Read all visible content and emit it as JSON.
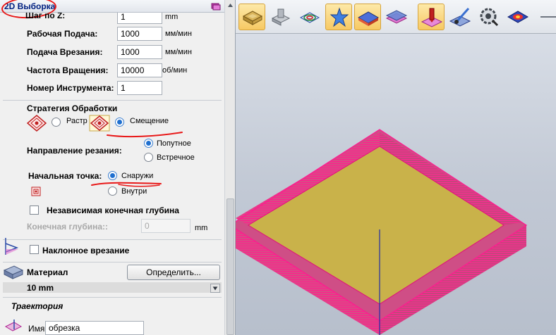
{
  "panel": {
    "title": "2D Выборка"
  },
  "params": {
    "step_z": {
      "label": "Шаг по Z:",
      "value": "1",
      "unit": "mm"
    },
    "feed": {
      "label": "Рабочая Подача:",
      "value": "1000",
      "unit": "мм/мин"
    },
    "plunge": {
      "label": "Подача Врезания:",
      "value": "1000",
      "unit": "мм/мин"
    },
    "spindle": {
      "label": "Частота Вращения:",
      "value": "10000",
      "unit": "об/мин"
    },
    "tool": {
      "label": "Номер Инструмента:",
      "value": "1"
    }
  },
  "strategy": {
    "label": "Стратегия Обработки",
    "options": [
      "Растр",
      "Смещение"
    ],
    "selected": "Смещение"
  },
  "direction": {
    "label": "Направление резания:",
    "options": [
      "Попутное",
      "Встречное"
    ],
    "selected": "Попутное"
  },
  "start_point": {
    "label": "Начальная точка:",
    "options": [
      "Снаружи",
      "Внутри"
    ],
    "selected": "Снаружи"
  },
  "independent_depth": {
    "label": "Независимая конечная глубина",
    "checked": false
  },
  "final_depth": {
    "label": "Конечная глубина::",
    "value": "0",
    "unit": "mm"
  },
  "ramp": {
    "label": "Наклонное врезание",
    "checked": false
  },
  "material": {
    "label": "Материал",
    "button": "Определить...",
    "value": "10 mm"
  },
  "trajectory": {
    "label": "Траектория",
    "name_label": "Имя:",
    "name_value": "обрезка"
  },
  "colors": {
    "annotation_red": "#e81818",
    "toolpath_magenta": "#e0107a",
    "pocket_floor": "#c9b24a",
    "toolbar_active": "#f7c963"
  },
  "toolbar_icons": [
    "material-block-icon",
    "model-view-icon",
    "vector-view-icon",
    "star-shape-icon",
    "layers-icon",
    "layer-stack-icon",
    "toolpath-tool-icon",
    "brush-icon",
    "gear-settings-icon",
    "eye-visibility-icon"
  ]
}
